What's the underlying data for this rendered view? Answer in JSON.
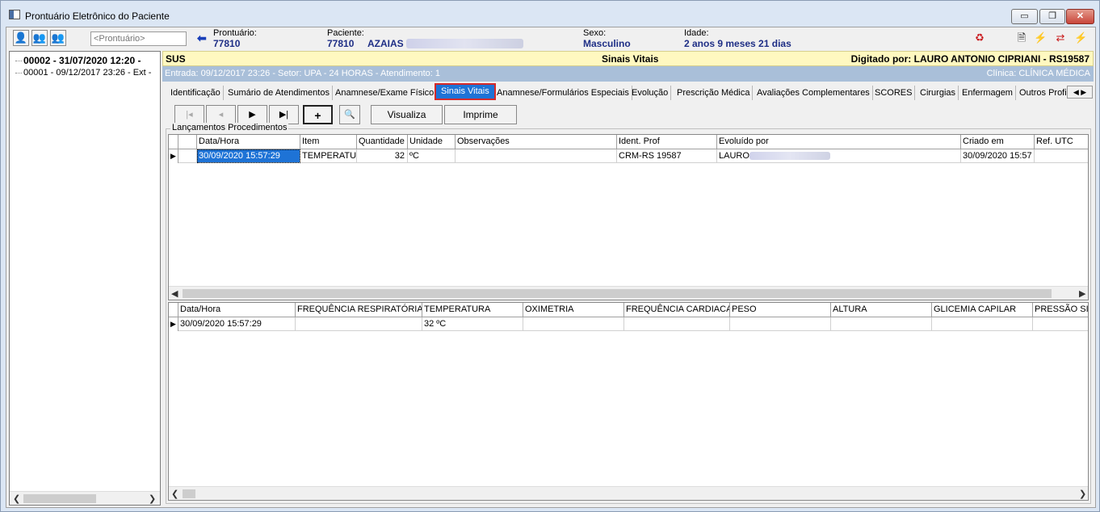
{
  "window": {
    "title": "Prontuário Eletrônico do Paciente",
    "controls": {
      "minimize": "▭",
      "maximize": "❐",
      "close": "✕"
    }
  },
  "toolbar": {
    "prontuario_placeholder": "<Prontuário>",
    "prontuario_label": "Prontuário:",
    "prontuario_value": "77810",
    "paciente_label": "Paciente:",
    "paciente_id": "77810",
    "paciente_name": "AZAIAS",
    "sexo_label": "Sexo:",
    "sexo_value": "Masculino",
    "idade_label": "Idade:",
    "idade_value": "2 anos 9 meses 21 dias"
  },
  "tree": {
    "items": [
      {
        "label": "00002 - 31/07/2020 12:20 -"
      },
      {
        "label": "00001 - 09/12/2017 23:26 - Ext -"
      }
    ]
  },
  "header": {
    "convenio": "SUS",
    "section": "Sinais Vitais",
    "digitado": "Digitado por: LAURO ANTONIO CIPRIANI - RS19587",
    "entrada": "Entrada: 09/12/2017 23:26 - Setor: UPA - 24 HORAS - Atendimento: 1",
    "clinica": "Clínica: CLÍNICA MÉDICA"
  },
  "tabs": [
    {
      "label": "Identificação"
    },
    {
      "label": "Sumário de Atendimentos"
    },
    {
      "label": "Anamnese/Exame Físico"
    },
    {
      "label": "Sinais Vitais"
    },
    {
      "label": "Anamnese/Formulários Especiais"
    },
    {
      "label": "Evolução"
    },
    {
      "label": "Prescrição Médica"
    },
    {
      "label": "Avaliações Complementares"
    },
    {
      "label": "SCORES"
    },
    {
      "label": "Cirurgias"
    },
    {
      "label": "Enfermagem"
    },
    {
      "label": "Outros Profi"
    }
  ],
  "nav": {
    "first": "|◂",
    "prev": "◂",
    "next": "▶",
    "last": "▶|",
    "add": "+",
    "visualiza": "Visualiza",
    "imprime": "Imprime"
  },
  "group": {
    "label": "Lançamentos Procedimentos"
  },
  "grid1": {
    "headers": [
      "Data/Hora",
      "Item",
      "Quantidade",
      "Unidade",
      "Observações",
      "Ident. Prof",
      "Evoluído por",
      "Criado em",
      "Ref. UTC"
    ],
    "row": [
      "30/09/2020 15:57:29",
      "TEMPERATU",
      "32",
      "ºC",
      "",
      "CRM-RS 19587",
      "LAURO",
      "30/09/2020 15:57",
      ""
    ]
  },
  "grid2": {
    "headers": [
      "Data/Hora",
      "FREQUÊNCIA RESPIRATÓRIA",
      "TEMPERATURA",
      "OXIMETRIA",
      "FREQUÊNCIA CARDIACA",
      "PESO",
      "ALTURA",
      "GLICEMIA CAPILAR",
      "PRESSÃO SI"
    ],
    "row": [
      "30/09/2020 15:57:29",
      "",
      "32 ºC",
      "",
      "",
      "",
      "",
      "",
      ""
    ]
  }
}
